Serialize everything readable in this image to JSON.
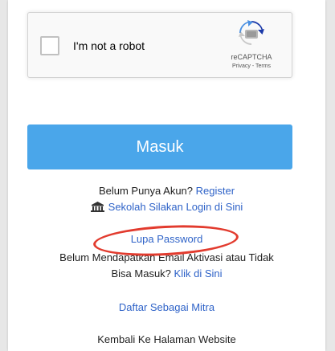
{
  "captcha": {
    "label": "I'm not a robot",
    "brand": "reCAPTCHA",
    "links": "Privacy - Terms"
  },
  "login": {
    "button_label": "Masuk"
  },
  "register": {
    "prompt": "Belum Punya Akun?",
    "link": "Register"
  },
  "school": {
    "icon": "school-building-icon",
    "link": "Sekolah Silakan Login di Sini"
  },
  "forgot": {
    "link": "Lupa Password"
  },
  "activation": {
    "line1": "Belum Mendapatkan Email Aktivasi atau Tidak",
    "line2_text": "Bisa Masuk?",
    "line2_link": "Klik di Sini"
  },
  "partner": {
    "link": "Daftar Sebagai Mitra"
  },
  "back": {
    "link": "Kembali Ke Halaman Website"
  },
  "colors": {
    "primary_button": "#4aa6ea",
    "link": "#2f63c8",
    "highlight": "#e23b2e"
  }
}
